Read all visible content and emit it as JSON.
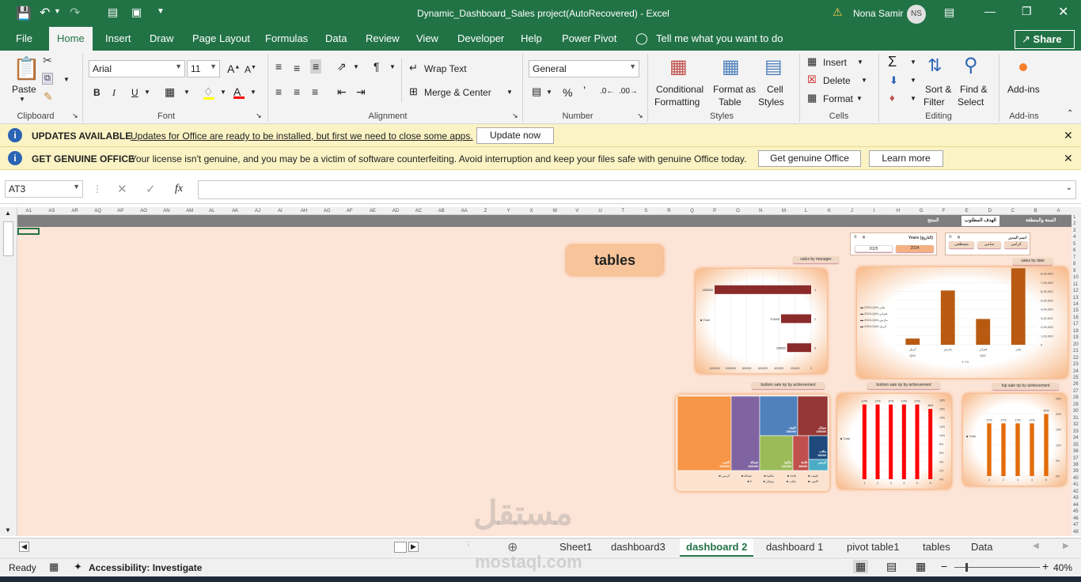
{
  "window": {
    "title": "Dynamic_Dashboard_Sales project(AutoRecovered)  -  Excel",
    "user_name": "Nona Samir",
    "user_initials": "NS",
    "title_bar_color": "#217346"
  },
  "ribbon_tabs": [
    "File",
    "Home",
    "Insert",
    "Draw",
    "Page Layout",
    "Formulas",
    "Data",
    "Review",
    "View",
    "Developer",
    "Help",
    "Power Pivot"
  ],
  "active_tab": "Home",
  "tell_me": "Tell me what you want to do",
  "share_label": "Share",
  "clipboard": {
    "paste": "Paste",
    "label": "Clipboard"
  },
  "font": {
    "name": "Arial",
    "size": "11",
    "label": "Font",
    "bold": "B",
    "italic": "I",
    "underline": "U"
  },
  "alignment": {
    "wrap_text": "Wrap Text",
    "merge_center": "Merge & Center",
    "label": "Alignment"
  },
  "number": {
    "format": "General",
    "label": "Number",
    "percent": "%"
  },
  "styles": {
    "conditional_1": "Conditional",
    "conditional_2": "Formatting",
    "format_table_1": "Format as",
    "format_table_2": "Table",
    "cell_styles_1": "Cell",
    "cell_styles_2": "Styles",
    "label": "Styles"
  },
  "cells": {
    "insert": "Insert",
    "delete": "Delete",
    "format": "Format",
    "label": "Cells"
  },
  "editing": {
    "sort_1": "Sort &",
    "sort_2": "Filter",
    "find_1": "Find &",
    "find_2": "Select",
    "label": "Editing"
  },
  "addins": {
    "button": "Add-ins",
    "label": "Add-ins"
  },
  "messages": {
    "updates_title": "UPDATES AVAILABLE",
    "updates_text": "Updates for Office are ready to be installed, but first we need to close some apps.",
    "update_now": "Update now",
    "genuine_title": "GET GENUINE OFFICE",
    "genuine_text": "Your license isn't genuine, and you may be a victim of software counterfeiting. Avoid interruption and keep your files safe with genuine Office today.",
    "get_genuine": "Get genuine Office",
    "learn_more": "Learn more"
  },
  "formula_bar": {
    "name_box": "AT3",
    "fx": "fx",
    "value": ""
  },
  "columns": [
    "A1",
    "AS",
    "AR",
    "AQ",
    "AP",
    "AO",
    "AN",
    "AM",
    "AL",
    "AK",
    "AJ",
    "AI",
    "AH",
    "AG",
    "AF",
    "AE",
    "AD",
    "AC",
    "AB",
    "AA",
    "Z",
    "Y",
    "X",
    "W",
    "V",
    "U",
    "T",
    "S",
    "R",
    "Q",
    "P",
    "O",
    "N",
    "M",
    "L",
    "K",
    "J",
    "I",
    "H",
    "G",
    "F",
    "E",
    "D",
    "C",
    "B",
    "A"
  ],
  "rows": [
    "1",
    "2",
    "3",
    "4",
    "5",
    "6",
    "7",
    "8",
    "9",
    "10",
    "11",
    "12",
    "13",
    "14",
    "15",
    "16",
    "17",
    "18",
    "19",
    "20",
    "21",
    "22",
    "23",
    "24",
    "25",
    "26",
    "27",
    "28",
    "29",
    "30",
    "31",
    "32",
    "33",
    "34",
    "35",
    "36",
    "37",
    "38",
    "39",
    "40",
    "41",
    "42",
    "43",
    "44",
    "45",
    "46",
    "47",
    "48"
  ],
  "dashboard": {
    "header_tabs": [
      "السنة والمنطقة",
      "الهدف المطلوب",
      "المنتج"
    ],
    "tables_button": "tables",
    "slicer_years": {
      "title": "Years (التاريخ)",
      "items": [
        "2024",
        "2025"
      ]
    },
    "slicer_manager": {
      "title": "اسم المدير",
      "items": [
        "كرامي",
        "سامي",
        "مصطفي"
      ]
    },
    "chart_titles": {
      "sales_by_manager": "sales by manager",
      "sales_by_date": "sales by date",
      "bottom_treemap": "bottom sale rip by achievement",
      "bottom_bars": "bottom sale rip by achievement",
      "top_bars": "top sale rip by achievement"
    },
    "total_label": "Total"
  },
  "chart_data": [
    {
      "type": "bar",
      "orientation": "horizontal",
      "title": "sales by manager",
      "categories": [
        "1",
        "2",
        "3"
      ],
      "values": [
        1300000,
        374000,
        298000
      ],
      "value_labels": [
        "1300000",
        "374000",
        "298000"
      ],
      "xlim": [
        0,
        1200000
      ],
      "ticks": [
        "1200000",
        "1000000",
        "800000",
        "600000",
        "400000",
        "200000",
        "0"
      ],
      "legend": "Total",
      "color": "#8b2a2a"
    },
    {
      "type": "bar",
      "title": "sales by date",
      "categories": [
        "أبريل",
        "مارس",
        "فبراير",
        "يناير"
      ],
      "values": [
        70000,
        610000,
        290000,
        860000
      ],
      "ylim": [
        0,
        800000
      ],
      "ticks": [
        "0",
        "1,00,000",
        "2,00,000",
        "3,00,000",
        "4,00,000",
        "5,00,000",
        "6,00,000",
        "7,00,000",
        "8,00,000"
      ],
      "legend": [
        "2024-Qtr1-يناير",
        "2024-Qtr1-فبراير",
        "2024-Qtr1-مارس",
        "2024-Qtr2-أبريل"
      ],
      "group_labels": [
        "Qtr2",
        "Qtr1"
      ],
      "year_label": "٢٠٢٤",
      "color": "#b85a12"
    },
    {
      "type": "heatmap",
      "title": "bottom sale rip by achievement",
      "tiles": [
        {
          "label": "الاتوب",
          "value": "680000",
          "color": "#f79646"
        },
        {
          "label": "غسالة",
          "value": "332000",
          "color": "#8064a2"
        },
        {
          "label": "تكييف",
          "value": "256000",
          "color": "#4f81bd"
        },
        {
          "label": "موبايل",
          "value": "185000",
          "color": "#953735"
        },
        {
          "label": "ماكينة",
          "value": "162000",
          "color": "#9bbb59"
        },
        {
          "label": "ثلاجة",
          "value": "83000",
          "color": "#c0504d"
        },
        {
          "label": "مكتب",
          "value": "54000",
          "color": "#1f497d"
        },
        {
          "label": "كرسي",
          "value": "",
          "color": "#4bacc6"
        }
      ],
      "legend": [
        "تكييف",
        "ثلاجة",
        "ماكينة",
        "غسالة",
        "كرسي",
        "الاتوب",
        "مكتب",
        "موبايل",
        "0"
      ]
    },
    {
      "type": "bar",
      "title": "bottom sale rip by achievement",
      "categories": [
        "1",
        "2",
        "3",
        "4",
        "5",
        "6"
      ],
      "values": [
        17,
        17,
        17,
        17,
        17,
        16
      ],
      "value_labels": [
        "17%",
        "17%",
        "17%",
        "17%",
        "17%",
        "16%"
      ],
      "ylim": [
        0,
        18
      ],
      "ticks": [
        "0%",
        "2%",
        "4%",
        "6%",
        "8%",
        "10%",
        "12%",
        "14%",
        "16%",
        "18%"
      ],
      "legend": "Total",
      "color": "#ff0000"
    },
    {
      "type": "bar",
      "title": "top sale rip by achievement",
      "categories": [
        "1",
        "2",
        "3",
        "4",
        "5"
      ],
      "values": [
        17,
        17,
        17,
        17,
        20
      ],
      "value_labels": [
        "17%",
        "17%",
        "17%",
        "17%",
        "20%"
      ],
      "ylim": [
        0,
        25
      ],
      "ticks": [
        "0%",
        "5%",
        "10%",
        "15%",
        "20%",
        "25%"
      ],
      "legend": "Total",
      "color": "#e36c09"
    }
  ],
  "sheet_tabs": [
    "Sheet1",
    "dashboard3",
    "dashboard 2",
    "dashboard 1",
    "pivot table1",
    "tables",
    "Data"
  ],
  "active_sheet": "dashboard 2",
  "status": {
    "ready": "Ready",
    "accessibility": "Accessibility: Investigate",
    "zoom": "40%"
  },
  "watermark": {
    "arabic": "مستقل",
    "latin": "mostaql.com"
  }
}
